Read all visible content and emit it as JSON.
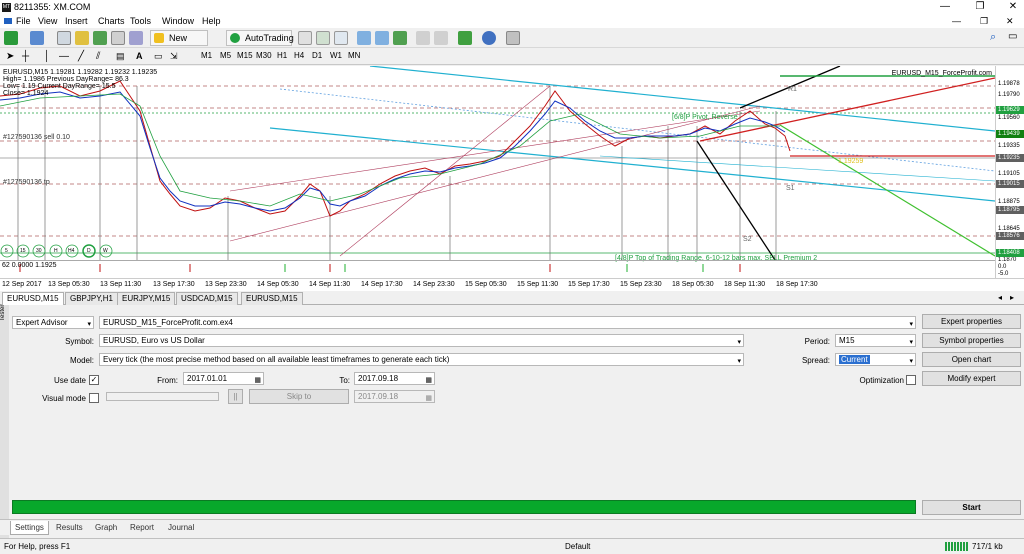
{
  "window": {
    "title": "8211355: XM.COM",
    "app_icon": "MT"
  },
  "menu": [
    "File",
    "View",
    "Insert",
    "Charts",
    "Tools",
    "Window",
    "Help"
  ],
  "toolbar": {
    "new_order": "New Order",
    "autotrading": "AutoTrading"
  },
  "timeframes": [
    "M1",
    "M5",
    "M15",
    "M30",
    "H1",
    "H4",
    "D1",
    "W1",
    "MN"
  ],
  "chart": {
    "info_lines": [
      "EURUSD,M15  1.19281 1.19282 1.19232 1.19235",
      "High= 1.1986 Previous DayRange= 86.3",
      "Low= 1.19 Current DayRange= 15.5",
      "Close= 1.1924"
    ],
    "indicator_name": "EURUSD_M15_ForceProfit.com",
    "label_sell": "#127590136 sell 0.10",
    "label_tp": "#127590136 tp",
    "label_pivot": "[6/8]P Pivot, Reverse",
    "label_range": "[4/8]P Top of Trading Range, 6-10-12 bars max, SELL Premium 2",
    "label_s1": "S1",
    "label_s2": "S2",
    "label_r1": "R1",
    "label_price_yellow": "1.19259",
    "buttons_round": [
      "5",
      "15",
      "30",
      "H",
      "H4",
      "D",
      "W"
    ],
    "indicator_label": "62 0.0000 1.1925",
    "price_labels": [
      "1.19878",
      "1.19790",
      "1.19560",
      "1.19335",
      "1.19105",
      "1.18875",
      "1.18645",
      "1.18400",
      "1.1870",
      "0.0",
      "-5.0"
    ],
    "price_boxes": [
      {
        "v": "1.19629",
        "c": "#20a040"
      },
      {
        "v": "1.19439",
        "c": "#108010"
      },
      {
        "v": "1.19235",
        "c": "#606060"
      },
      {
        "v": "1.19015",
        "c": "#606060"
      },
      {
        "v": "1.18795",
        "c": "#606060"
      },
      {
        "v": "1.18576",
        "c": "#606060"
      },
      {
        "v": "1.18408",
        "c": "#20a040"
      }
    ],
    "time_labels": [
      "12 Sep 2017",
      "13 Sep 05:30",
      "13 Sep 11:30",
      "13 Sep 17:30",
      "13 Sep 23:30",
      "14 Sep 05:30",
      "14 Sep 11:30",
      "14 Sep 17:30",
      "14 Sep 23:30",
      "15 Sep 05:30",
      "15 Sep 11:30",
      "15 Sep 17:30",
      "15 Sep 23:30",
      "18 Sep 05:30",
      "18 Sep 11:30",
      "18 Sep 17:30"
    ]
  },
  "symbol_tabs": [
    "EURUSD,M15",
    "GBPJPY,H1",
    "EURJPY,M15",
    "USDCAD,M15",
    "EURUSD,M15"
  ],
  "tester": {
    "side_label": "Tester",
    "type_value": "Expert Advisor",
    "expert_value": "EURUSD_M15_ForceProfit.com.ex4",
    "symbol_label": "Symbol:",
    "symbol_value": "EURUSD, Euro vs US Dollar",
    "model_label": "Model:",
    "model_value": "Every tick (the most precise method based on all available least timeframes to generate each tick)",
    "use_date_label": "Use date",
    "use_date_checked": "✓",
    "from_label": "From:",
    "from_value": "2017.01.01",
    "to_label": "To:",
    "to_value": "2017.09.18",
    "visual_label": "Visual mode",
    "pause_label": "||",
    "skip_label": "Skip to",
    "skip_value": "2017.09.18",
    "period_label": "Period:",
    "period_value": "M15",
    "spread_label": "Spread:",
    "spread_value": "Current",
    "optimization_label": "Optimization",
    "btn_expert_props": "Expert properties",
    "btn_symbol_props": "Symbol properties",
    "btn_open_chart": "Open chart",
    "btn_modify": "Modify expert",
    "btn_start": "Start",
    "progress": 1.0
  },
  "bottom_tabs": [
    "Settings",
    "Results",
    "Graph",
    "Report",
    "Journal"
  ],
  "status": {
    "help": "For Help, press F1",
    "profile": "Default",
    "traffic": "717/1 kb"
  }
}
